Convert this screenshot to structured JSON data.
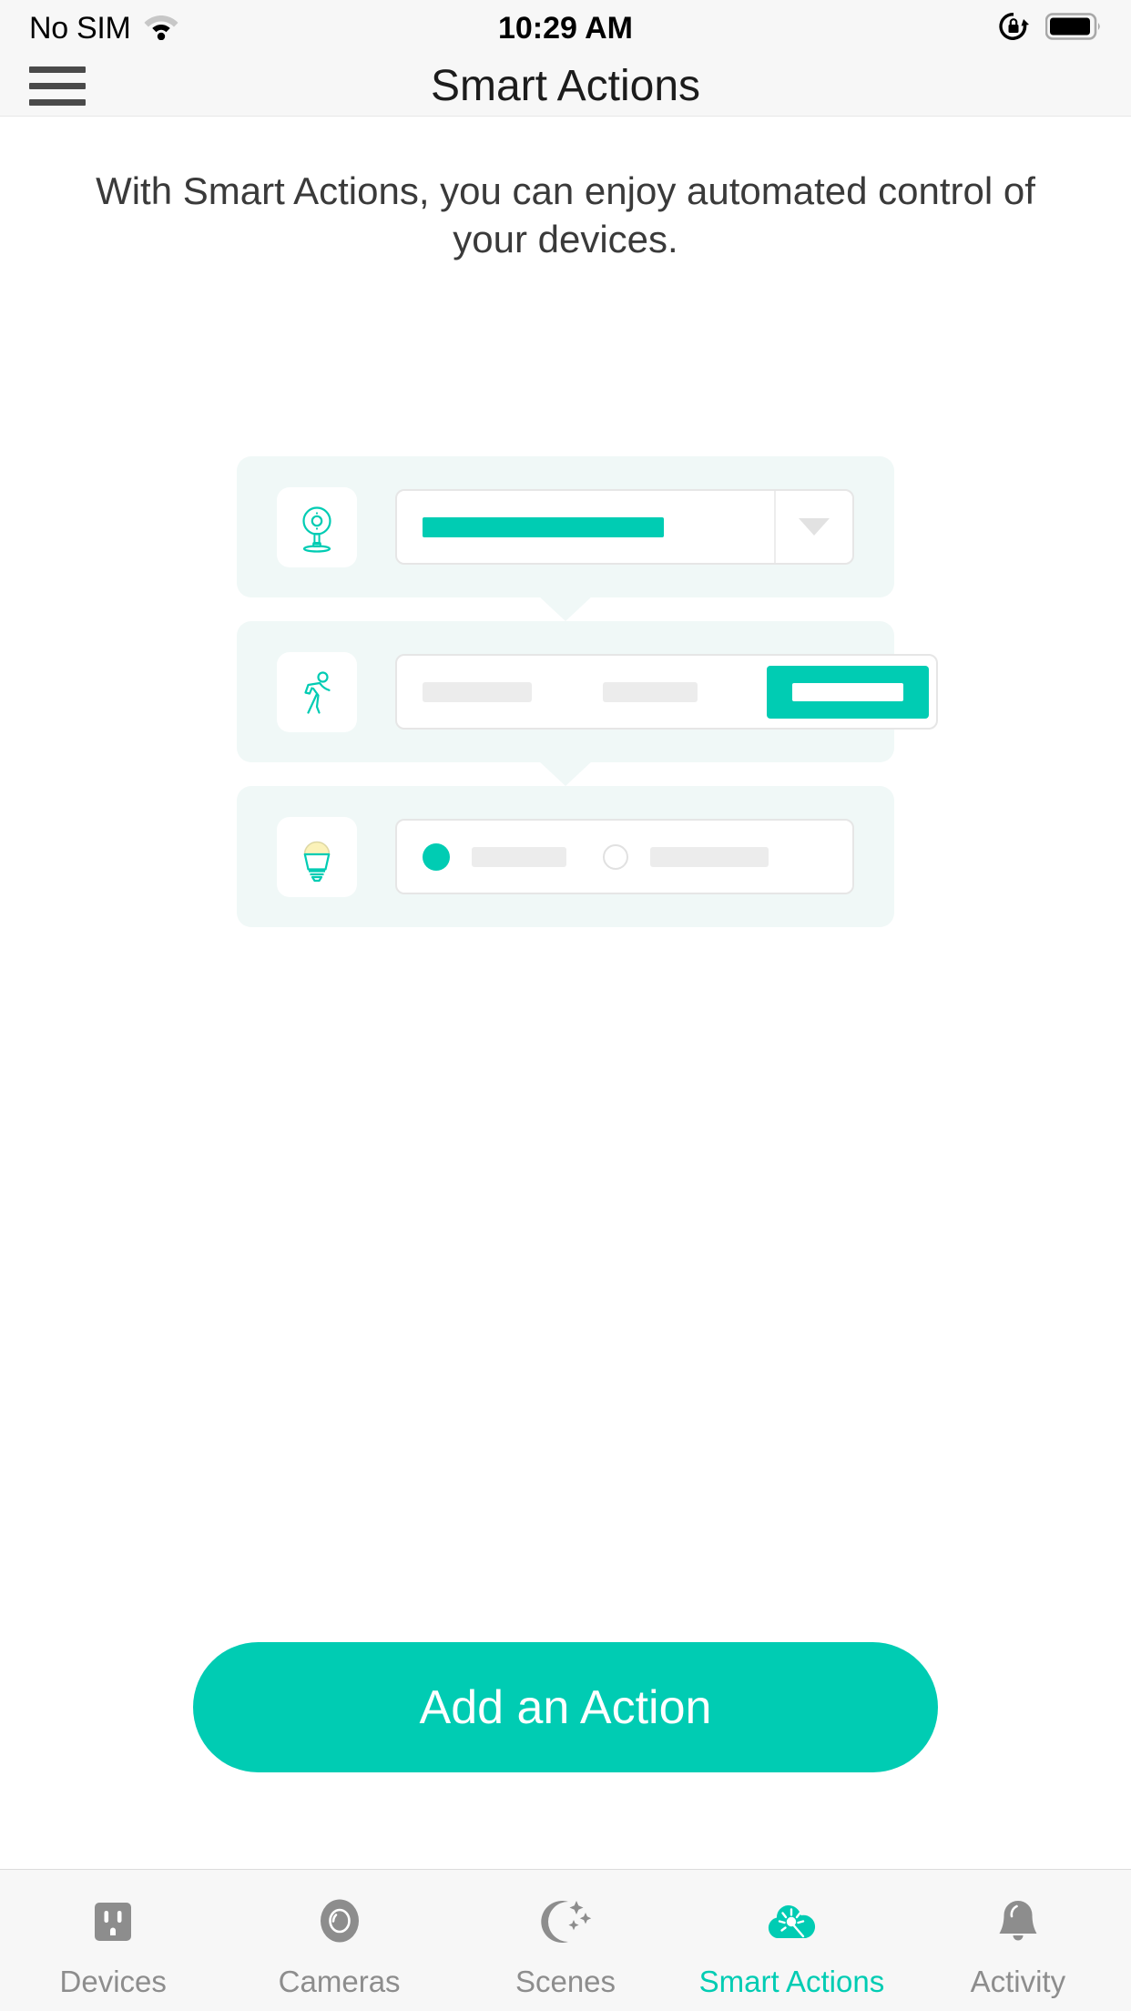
{
  "status_bar": {
    "carrier": "No SIM",
    "time": "10:29 AM",
    "wifi_icon": "wifi-icon",
    "rotation_lock_icon": "rotation-lock-icon",
    "battery_icon": "battery-full-icon"
  },
  "nav": {
    "menu_icon": "hamburger-menu-icon",
    "title": "Smart Actions"
  },
  "main": {
    "description": "With Smart Actions, you can enjoy automated control of your devices.",
    "illustration": {
      "cards": [
        {
          "icon": "camera-icon",
          "type": "dropdown-row"
        },
        {
          "icon": "motion-walking-icon",
          "type": "button-row"
        },
        {
          "icon": "lightbulb-icon",
          "type": "radio-row"
        }
      ]
    },
    "cta_label": "Add an Action"
  },
  "tabbar": {
    "items": [
      {
        "label": "Devices",
        "icon": "power-outlet-icon",
        "active": false
      },
      {
        "label": "Cameras",
        "icon": "camera-lens-icon",
        "active": false
      },
      {
        "label": "Scenes",
        "icon": "moon-stars-icon",
        "active": false
      },
      {
        "label": "Smart Actions",
        "icon": "cloud-magic-wand-icon",
        "active": true
      },
      {
        "label": "Activity",
        "icon": "bell-icon",
        "active": false
      }
    ]
  },
  "colors": {
    "accent": "#00ccb3",
    "card_bg": "#f0f8f7",
    "inactive_tab": "#8d8d8d",
    "bulb_glow": "#fbf2b9",
    "chrome_bg": "#f7f7f7"
  }
}
